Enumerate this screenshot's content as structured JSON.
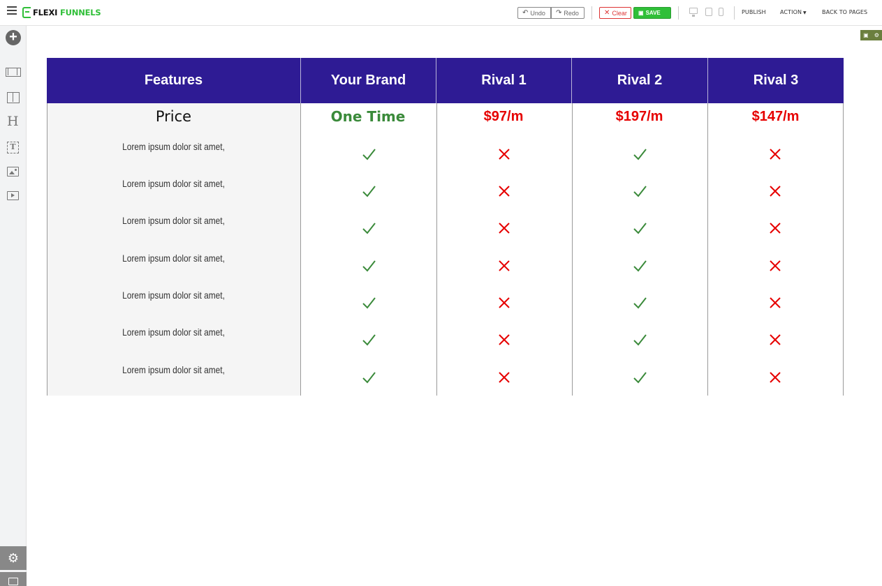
{
  "app": {
    "logo_prefix": "FLEXI",
    "logo_suffix": "FUNNELS"
  },
  "toolbar": {
    "undo_label": "Undo",
    "redo_label": "Redo",
    "clear_label": "Clear",
    "save_label": "SAVE",
    "publish_label": "PUBLISH",
    "action_label": "ACTION",
    "back_label": "BACK TO PAGES"
  },
  "colors": {
    "accent_green": "#2fbf38",
    "header_purple": "#2e1b94",
    "check_green": "#3a8a3a",
    "cross_red": "#e60000"
  },
  "table": {
    "headers": [
      "Features",
      "Your Brand",
      "Rival 1",
      "Rival 2",
      "Rival 3"
    ],
    "price_label": "Price",
    "prices": [
      "One Time",
      "$97/m",
      "$197/m",
      "$147/m"
    ],
    "features": [
      "Lorem ipsum dolor sit amet,",
      "Lorem ipsum dolor sit amet,",
      "Lorem ipsum dolor sit amet,",
      "Lorem ipsum dolor sit amet,",
      "Lorem ipsum dolor sit amet,",
      "Lorem ipsum dolor sit amet,",
      "Lorem ipsum dolor sit amet,"
    ],
    "marks": {
      "your_brand": [
        "check",
        "check",
        "check",
        "check",
        "check",
        "check",
        "check"
      ],
      "rival_1": [
        "cross",
        "cross",
        "cross",
        "cross",
        "cross",
        "cross",
        "cross"
      ],
      "rival_2": [
        "check",
        "check",
        "check",
        "check",
        "check",
        "check",
        "check"
      ],
      "rival_3": [
        "cross",
        "cross",
        "cross",
        "cross",
        "cross",
        "cross",
        "cross"
      ]
    }
  }
}
